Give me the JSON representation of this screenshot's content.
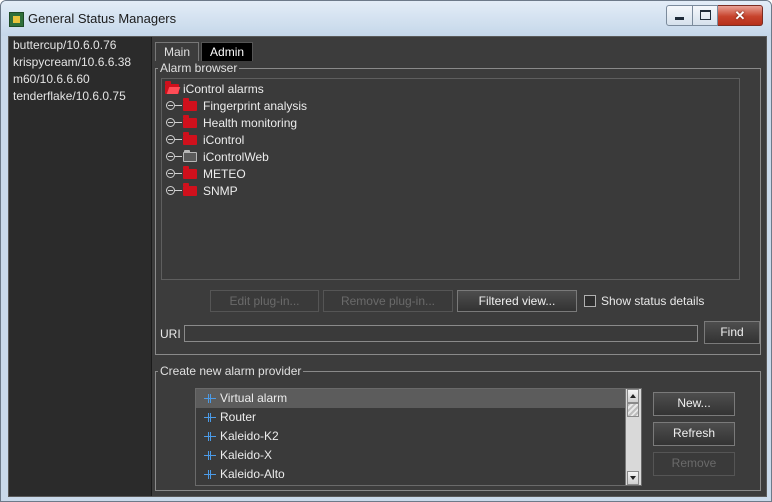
{
  "window": {
    "title": "General Status Managers"
  },
  "servers": [
    "buttercup/10.6.0.76",
    "krispycream/10.6.6.38",
    "m60/10.6.6.60",
    "tenderflake/10.6.0.75"
  ],
  "tabs": [
    {
      "label": "Main",
      "active": true
    },
    {
      "label": "Admin",
      "active": false
    }
  ],
  "alarm_browser": {
    "legend": "Alarm browser",
    "root": "iControl alarms",
    "nodes": [
      {
        "label": "Fingerprint analysis",
        "folder": "red-folder-icon"
      },
      {
        "label": "Health monitoring",
        "folder": "red-folder-icon"
      },
      {
        "label": "iControl",
        "folder": "red-folder-icon"
      },
      {
        "label": "iControlWeb",
        "folder": "grey-folder-icon"
      },
      {
        "label": "METEO",
        "folder": "red-folder-icon"
      },
      {
        "label": "SNMP",
        "folder": "red-folder-icon"
      }
    ],
    "edit_plugin": "Edit plug-in...",
    "remove_plugin": "Remove plug-in...",
    "filtered_view": "Filtered view...",
    "show_status_details": "Show status details",
    "uri_label": "URI",
    "uri_value": "",
    "find": "Find"
  },
  "provider": {
    "legend": "Create new alarm provider",
    "items": [
      {
        "label": "Virtual alarm",
        "selected": true
      },
      {
        "label": "Router",
        "selected": false
      },
      {
        "label": "Kaleido-K2",
        "selected": false
      },
      {
        "label": "Kaleido-X",
        "selected": false
      },
      {
        "label": "Kaleido-Alto",
        "selected": false
      }
    ],
    "new": "New...",
    "refresh": "Refresh",
    "remove": "Remove"
  },
  "colors": {
    "background": "#3c3c3c",
    "folder_red": "#d0101c",
    "provider_icon": "#4b9be8",
    "close_button": "#c7432c"
  }
}
